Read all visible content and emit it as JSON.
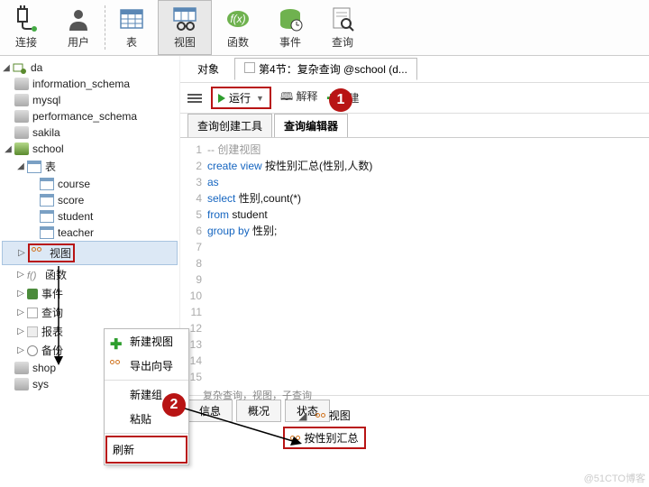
{
  "toolbar": [
    {
      "name": "connect",
      "label": "连接",
      "icon": "plug"
    },
    {
      "name": "user",
      "label": "用户",
      "icon": "user"
    },
    {
      "name": "table",
      "label": "表",
      "icon": "table"
    },
    {
      "name": "view",
      "label": "视图",
      "icon": "view",
      "active": true
    },
    {
      "name": "function",
      "label": "函数",
      "icon": "fx"
    },
    {
      "name": "event",
      "label": "事件",
      "icon": "event"
    },
    {
      "name": "query",
      "label": "查询",
      "icon": "query"
    }
  ],
  "tree": {
    "connection": "da",
    "databases": [
      "information_schema",
      "mysql",
      "performance_schema",
      "sakila"
    ],
    "open_db": "school",
    "tables_label": "表",
    "tables": [
      "course",
      "score",
      "student",
      "teacher"
    ],
    "nodes": {
      "view": "视图",
      "func": "函数",
      "event": "事件",
      "query": "查询",
      "report": "报表",
      "backup": "备份"
    },
    "after": [
      "shop",
      "sys"
    ]
  },
  "context_menu": {
    "new_view": "新建视图",
    "export": "导出向导",
    "new_group": "新建组",
    "paste": "粘贴",
    "refresh": "刷新"
  },
  "tabs": {
    "objects": "对象",
    "query_tab": "第4节：复杂查询 @school (d..."
  },
  "actions": {
    "run": "运行",
    "explain": "解释",
    "new": "新建"
  },
  "subtabs": {
    "builder": "查询创建工具",
    "editor": "查询编辑器"
  },
  "code": {
    "l1": "-- 创建视图",
    "l2a": "create view",
    "l2b": " 按性别汇总(性别,人数)",
    "l3": "as",
    "l4a": "select",
    "l4b": " 性别,count(*)",
    "l5a": "from",
    "l5b": " student",
    "l6a": "group by",
    "l6b": " 性别;"
  },
  "bottom_tabs": {
    "info": "信息",
    "summary": "概况",
    "status": "状态"
  },
  "status_text": "复杂查询，视图，子查询",
  "snippet": {
    "parent": "视图",
    "child": "按性别汇总"
  },
  "callouts": {
    "one": "1",
    "two": "2"
  },
  "watermark": "@51CTO博客"
}
